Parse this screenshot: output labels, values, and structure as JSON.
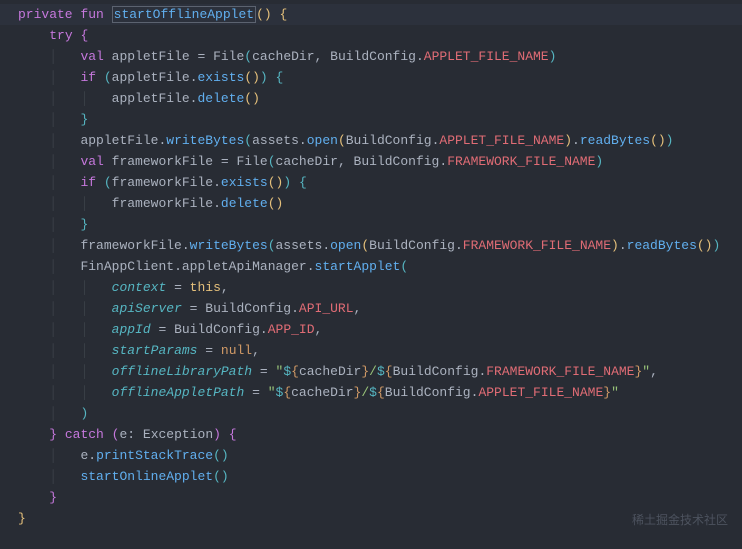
{
  "watermark": "稀土掘金技术社区",
  "code": {
    "kw_private": "private",
    "kw_fun": "fun",
    "fn_name": "startOfflineApplet",
    "kw_try": "try",
    "kw_val": "val",
    "var_appletFile": "appletFile",
    "cls_File": "File",
    "var_cacheDir": "cacheDir",
    "cls_BuildConfig": "BuildConfig",
    "const_APPLET_FILE_NAME": "APPLET_FILE_NAME",
    "kw_if": "if",
    "fn_exists": "exists",
    "fn_delete": "delete",
    "fn_writeBytes": "writeBytes",
    "var_assets": "assets",
    "fn_open": "open",
    "fn_readBytes": "readBytes",
    "var_frameworkFile": "frameworkFile",
    "const_FRAMEWORK_FILE_NAME": "FRAMEWORK_FILE_NAME",
    "cls_FinAppClient": "FinAppClient",
    "prop_appletApiManager": "appletApiManager",
    "fn_startApplet": "startApplet",
    "param_context": "context",
    "kw_this": "this",
    "param_apiServer": "apiServer",
    "const_API_URL": "API_URL",
    "param_appId": "appId",
    "const_APP_ID": "APP_ID",
    "param_startParams": "startParams",
    "kw_null": "null",
    "param_offlineLibraryPath": "offlineLibraryPath",
    "param_offlineAppletPath": "offlineAppletPath",
    "kw_catch": "catch",
    "var_e": "e",
    "cls_Exception": "Exception",
    "fn_printStackTrace": "printStackTrace",
    "fn_startOnlineApplet": "startOnlineApplet",
    "str_slash": "/"
  }
}
